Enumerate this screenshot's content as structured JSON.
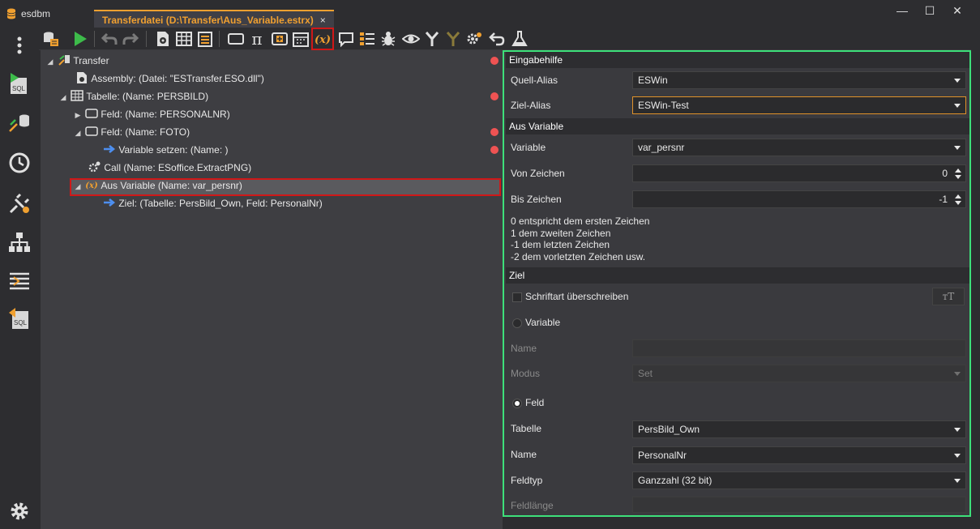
{
  "app": {
    "name": "esdbm"
  },
  "tab": {
    "title": "Transferdatei (D:\\Transfer\\Aus_Variable.estrx)",
    "close": "×"
  },
  "window": {
    "minimize": "—",
    "maximize": "☐",
    "close": "✕"
  },
  "colors": {
    "accent": "#f0a030",
    "error": "#ef5353",
    "highlight": "#d01818",
    "panel_border": "#3de07a",
    "run": "#3dbb4a",
    "link_arrow": "#4d8ff0"
  },
  "toolbar": {
    "variable_icon_text": "(x)"
  },
  "tree": {
    "items": [
      {
        "label": "Transfer",
        "icon": "transfer-icon",
        "expander": "◢",
        "error": true
      },
      {
        "label": "Assembly: (Datei: \"ESTransfer.ESO.dll\")",
        "icon": "assembly-icon",
        "expander": "",
        "error": false
      },
      {
        "label": "Tabelle: (Name: PERSBILD)",
        "icon": "table-icon",
        "expander": "◢",
        "error": true
      },
      {
        "label": "Feld: (Name: PERSONALNR)",
        "icon": "field-icon",
        "expander": "▶",
        "error": false
      },
      {
        "label": "Feld: (Name: FOTO)",
        "icon": "field-icon",
        "expander": "◢",
        "error": true
      },
      {
        "label": "Variable setzen: (Name: )",
        "icon": "arrow-icon",
        "expander": "",
        "error": true
      },
      {
        "label": "Call (Name: ESoffice.ExtractPNG)",
        "icon": "gears-icon",
        "expander": "",
        "error": false
      },
      {
        "label": "Aus Variable (Name: var_persnr)",
        "icon": "variable-icon",
        "icon_text": "(x)",
        "expander": "◢",
        "error": false,
        "selected": true
      },
      {
        "label": "Ziel: (Tabelle: PersBild_Own, Feld: PersonalNr)",
        "icon": "arrow-icon",
        "expander": "",
        "error": false
      }
    ]
  },
  "props": {
    "sec_eingabehilfe": "Eingabehilfe",
    "quell_alias_label": "Quell-Alias",
    "quell_alias_value": "ESWin",
    "ziel_alias_label": "Ziel-Alias",
    "ziel_alias_value": "ESWin-Test",
    "sec_aus_variable": "Aus Variable",
    "variable_label": "Variable",
    "variable_value": "var_persnr",
    "von_label": "Von Zeichen",
    "von_value": "0",
    "bis_label": "Bis Zeichen",
    "bis_value": "-1",
    "hint_lines": [
      "0 entspricht dem ersten Zeichen",
      "1 dem zweiten Zeichen",
      "-1 dem letzten Zeichen",
      "-2 dem vorletzten Zeichen usw."
    ],
    "sec_ziel": "Ziel",
    "schriftart_label": "Schriftart überschreiben",
    "font_button": "тT",
    "radio_variable_label": "Variable",
    "name_label": "Name",
    "name_value": "",
    "modus_label": "Modus",
    "modus_value": "Set",
    "radio_feld_label": "Feld",
    "tabelle_label": "Tabelle",
    "tabelle_value": "PersBild_Own",
    "feld_name_label": "Name",
    "feld_name_value": "PersonalNr",
    "feldtyp_label": "Feldtyp",
    "feldtyp_value": "Ganzzahl (32 bit)",
    "feldlaenge_label": "Feldlänge",
    "feldlaenge_value": ""
  }
}
